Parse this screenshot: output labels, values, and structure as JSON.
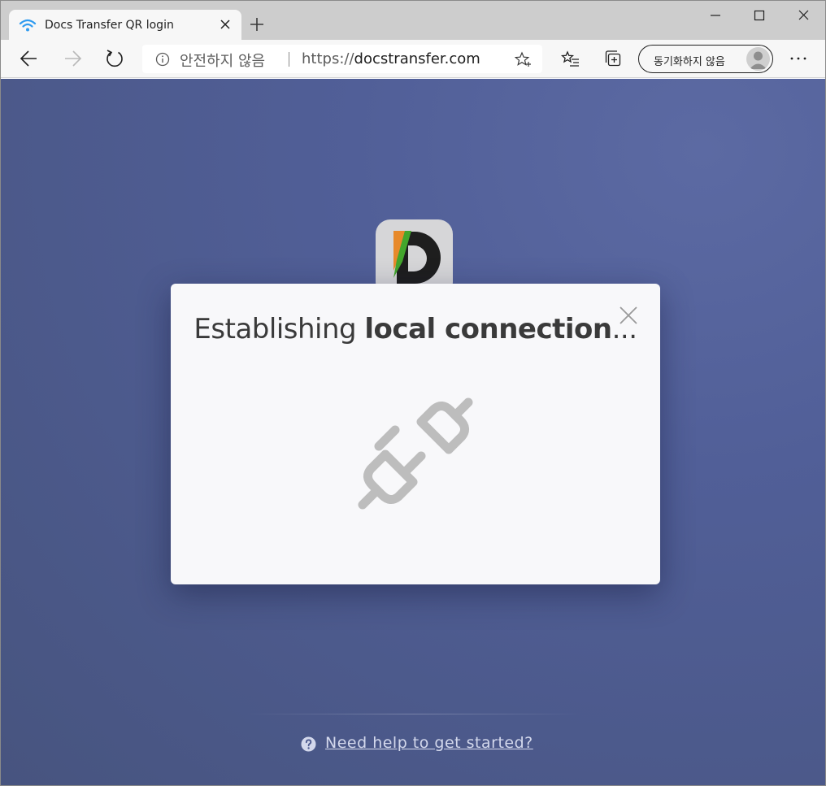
{
  "browser": {
    "tab": {
      "title": "Docs Transfer QR login"
    },
    "address": {
      "security_label": "안전하지 않음",
      "url_prefix": "https://",
      "url_host": "docstransfer.com"
    },
    "profile": {
      "label": "동기화하지 않음"
    }
  },
  "dialog": {
    "title_regular": "Establishing ",
    "title_bold": "local connection",
    "title_suffix": "..."
  },
  "footer": {
    "help_text": "Need help to get started?"
  },
  "colors": {
    "background": "#515f98",
    "dialog": "#f8f8fa",
    "plug_icon": "#bdbdbd",
    "link": "#d3d8ec",
    "wifi_icon": "#2f9bf0"
  }
}
